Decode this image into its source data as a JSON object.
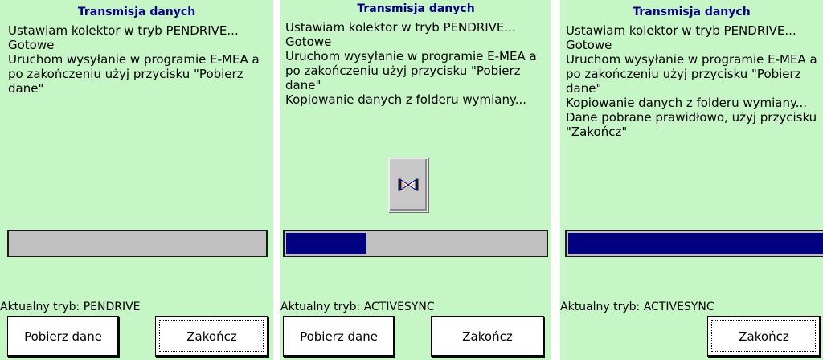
{
  "screens": [
    {
      "title": "Transmisja danych",
      "log": "Ustawiam kolektor w tryb PENDRIVE...\nGotowe\nUruchom wysyłanie w programie E-MEA a\npo zakończeniu użyj przycisku \"Pobierz\ndane\"",
      "progress_percent": 0,
      "mode_label": "Aktualny tryb: PENDRIVE",
      "buttons": {
        "fetch": "Pobierz dane",
        "finish": "Zakończ"
      },
      "busy": false
    },
    {
      "title": "Transmisja danych",
      "log": "Ustawiam kolektor w tryb PENDRIVE...\nGotowe\nUruchom wysyłanie w programie E-MEA a\npo zakończeniu użyj przycisku \"Pobierz\ndane\"\nKopiowanie danych z folderu wymiany...",
      "progress_percent": 31,
      "mode_label": "Aktualny tryb: ACTIVESYNC",
      "buttons": {
        "fetch": "Pobierz dane",
        "finish": "Zakończ"
      },
      "busy": true,
      "busy_icon": "hourglass-icon"
    },
    {
      "title": "Transmisja danych",
      "log": "Ustawiam kolektor w tryb PENDRIVE...\nGotowe\nUruchom wysyłanie w programie E-MEA a\npo zakończeniu użyj przycisku \"Pobierz\ndane\"\nKopiowanie danych z folderu wymiany...\nDane pobrane prawidłowo, użyj przycisku\n\"Zakończ\"",
      "progress_percent": 100,
      "mode_label": "Aktualny tryb: ACTIVESYNC",
      "buttons": {
        "finish": "Zakończ"
      },
      "busy": false
    }
  ],
  "colors": {
    "background": "#c6f5c6",
    "title": "#000080",
    "progress_fill": "#000080",
    "progress_track": "#c0c0c0"
  }
}
